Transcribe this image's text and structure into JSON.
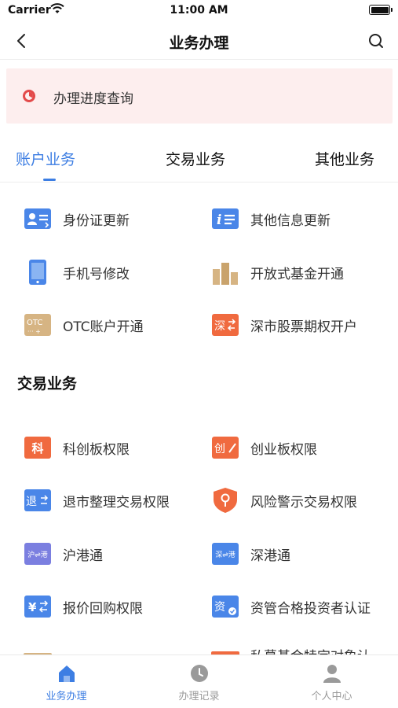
{
  "status_bar": {
    "carrier": "Carrier",
    "time": "11:00 AM"
  },
  "nav": {
    "title": "业务办理",
    "back_icon": "chevron-left-icon",
    "search_icon": "search-icon"
  },
  "banner": {
    "label": "办理进度查询",
    "icon": "progress-pie-icon",
    "accent": "#e34a4a",
    "background": "#fdeeee"
  },
  "tabs": [
    {
      "label": "账户业务",
      "active": true
    },
    {
      "label": "交易业务",
      "active": false
    },
    {
      "label": "其他业务",
      "active": false
    }
  ],
  "account_items": [
    {
      "label": "身份证更新",
      "icon": "id-card-icon",
      "color": "#4a86e8"
    },
    {
      "label": "其他信息更新",
      "icon": "info-edit-icon",
      "color": "#4a86e8"
    },
    {
      "label": "手机号修改",
      "icon": "phone-icon",
      "color": "#4a86e8"
    },
    {
      "label": "开放式基金开通",
      "icon": "fund-bars-icon",
      "color": "#d6b483"
    },
    {
      "label": "OTC账户开通",
      "icon": "otc-icon",
      "color": "#d6b483"
    },
    {
      "label": "深市股票期权开户",
      "icon": "sz-option-icon",
      "color": "#f06a3f"
    }
  ],
  "trade_section": {
    "title": "交易业务"
  },
  "trade_items": [
    {
      "label": "科创板权限",
      "icon": "star-market-icon",
      "color": "#f06a3f",
      "glyph": "科"
    },
    {
      "label": "创业板权限",
      "icon": "gem-board-icon",
      "color": "#f06a3f",
      "glyph": "创"
    },
    {
      "label": "退市整理交易权限",
      "icon": "delisting-icon",
      "color": "#4a86e8",
      "glyph": "退"
    },
    {
      "label": "风险警示交易权限",
      "icon": "risk-shield-icon",
      "color": "#f06a3f"
    },
    {
      "label": "沪港通",
      "icon": "sh-hk-connect-icon",
      "color": "#7b7fe0",
      "glyph": "沪⇌港"
    },
    {
      "label": "深港通",
      "icon": "sz-hk-connect-icon",
      "color": "#4a86e8",
      "glyph": "深⇌港"
    },
    {
      "label": "报价回购权限",
      "icon": "repo-icon",
      "color": "#4a86e8",
      "glyph": "¥"
    },
    {
      "label": "资管合格投资者认证",
      "icon": "asset-mgmt-icon",
      "color": "#4a86e8",
      "glyph": "资"
    }
  ],
  "partial_item": {
    "label": "私募基金特定对象认"
  },
  "otc_glyph": "OTC",
  "sz_glyph": "深",
  "tab_bar": [
    {
      "label": "业务办理",
      "icon": "home-icon",
      "active": true
    },
    {
      "label": "办理记录",
      "icon": "clock-icon",
      "active": false
    },
    {
      "label": "个人中心",
      "icon": "user-icon",
      "active": false
    }
  ]
}
